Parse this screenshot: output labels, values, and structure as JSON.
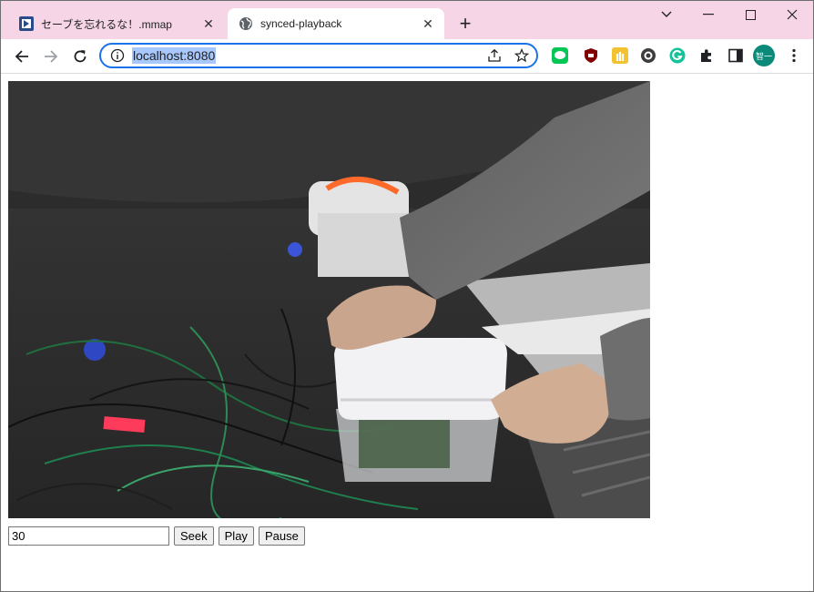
{
  "browser": {
    "tabs": [
      {
        "title": "セーブを忘れるな！.mmap",
        "active": false,
        "favicon": "mindmap-icon"
      },
      {
        "title": "synced-playback",
        "active": true,
        "favicon": "globe-icon"
      }
    ],
    "address_bar": {
      "url": "localhost:8080"
    },
    "profile_initial": "智一"
  },
  "page": {
    "seek_input_value": "30",
    "seek_label": "Seek",
    "play_label": "Play",
    "pause_label": "Pause"
  },
  "colors": {
    "tabstrip": "#f6d6e6",
    "omnibox_border": "#1a73e8",
    "url_highlight": "#a8c7fa",
    "profile_avatar": "#0b8a7a"
  }
}
